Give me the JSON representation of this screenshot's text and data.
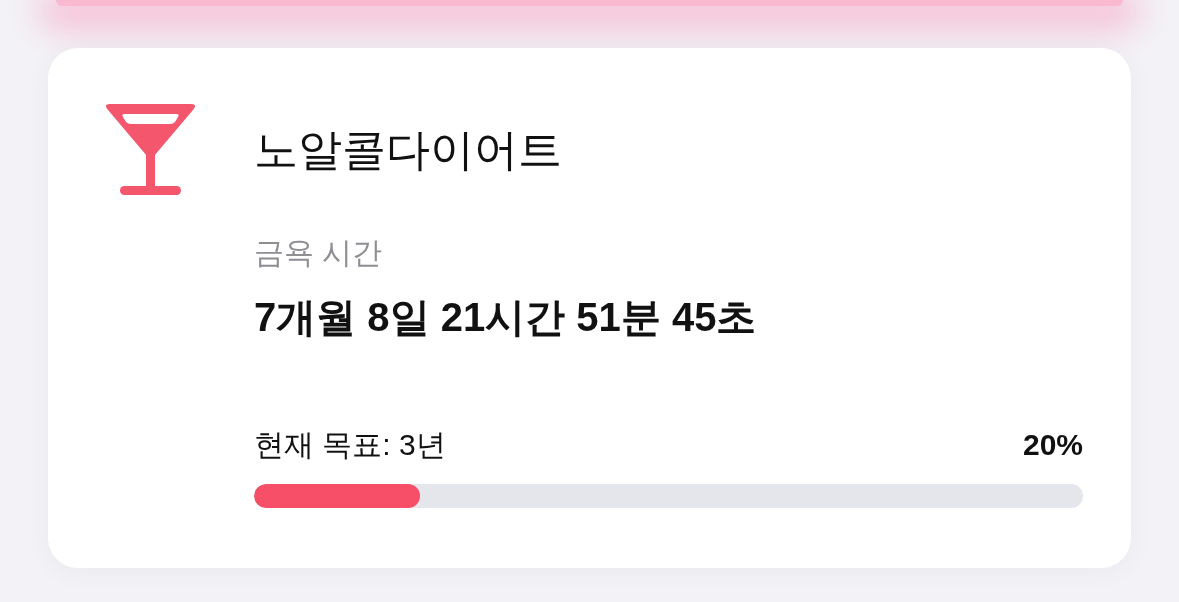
{
  "card": {
    "title": "노알콜다이어트",
    "elapsed_label": "금욕 시간",
    "elapsed": "7개월 8일 21시간 51분 45초",
    "goal": "현재 목표: 3년",
    "percent": "20%",
    "progress": {
      "level": 0.2
    }
  }
}
